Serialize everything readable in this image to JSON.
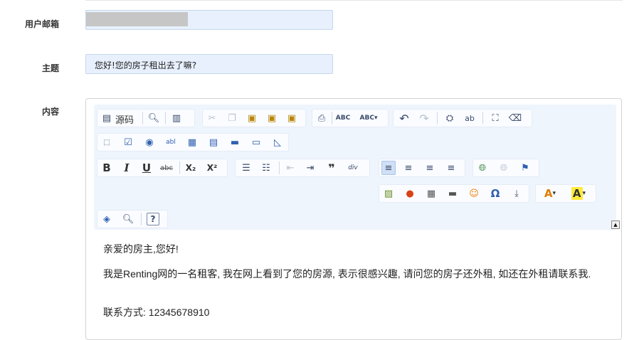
{
  "form": {
    "email_label": "用户邮箱",
    "subject_label": "主题",
    "subject_value": "您好!您的房子租出去了嘛?",
    "content_label": "内容"
  },
  "toolbar": {
    "source_label": "源码",
    "rows": [
      [
        "source-doc-icon",
        "preview-icon",
        "templates-icon",
        "cut-icon",
        "copy-icon",
        "paste-icon",
        "paste-text-icon",
        "paste-word-icon",
        "print-icon",
        "spellcheck-icon",
        "spellcheck-dropdown-icon",
        "undo-icon",
        "redo-icon",
        "find-icon",
        "replace-icon",
        "select-all-icon",
        "remove-format-icon"
      ],
      [
        "form-icon",
        "checkbox-icon",
        "radio-icon",
        "textfield-icon",
        "textarea-icon",
        "select-icon",
        "button-icon",
        "image-button-icon",
        "hidden-field-icon"
      ],
      [
        "bold-icon",
        "italic-icon",
        "underline-icon",
        "strike-icon",
        "subscript-icon",
        "superscript-icon",
        "numbered-list-icon",
        "bulleted-list-icon",
        "outdent-icon",
        "indent-icon",
        "blockquote-icon",
        "div-icon",
        "align-left-icon",
        "align-center-icon",
        "align-right-icon",
        "align-justify-icon",
        "link-icon",
        "unlink-icon",
        "anchor-icon"
      ],
      [
        "image-icon",
        "flash-icon",
        "table-icon",
        "horizontal-rule-icon",
        "smiley-icon",
        "special-char-icon",
        "page-break-icon",
        "text-color-icon",
        "bg-color-icon"
      ],
      [
        "maximize-icon",
        "show-blocks-icon",
        "about-icon"
      ]
    ],
    "glyphs": {
      "bold": "B",
      "italic": "I",
      "underline": "U",
      "strike": "abc",
      "sub": "X₂",
      "sup": "X²",
      "quote": "❞",
      "div": "div",
      "omega": "Ω",
      "help": "?",
      "text_color": "A",
      "bg_color": "A"
    }
  },
  "collapse_toggle": "▲",
  "editor_content": {
    "greeting": "亲爱的房主,您好!",
    "body": "我是Renting网的一名租客, 我在网上看到了您的房源, 表示很感兴趣, 请问您的房子还外租, 如还在外租请联系我.",
    "contact": "联系方式: 12345678910"
  },
  "colors": {
    "field_bg": "#e8f0fe",
    "toolbar_bg": "#eff5fd",
    "editor_border": "#d3d3d3"
  }
}
